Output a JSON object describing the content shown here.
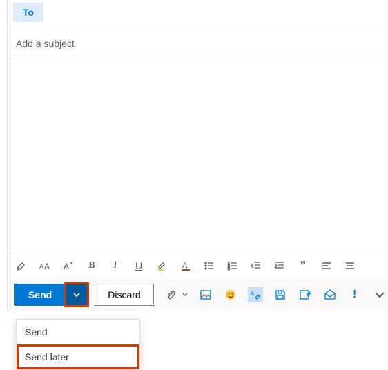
{
  "compose": {
    "to_label": "To",
    "subject_placeholder": "Add a subject"
  },
  "format": {
    "bold": "B",
    "italic": "I",
    "underline": "U",
    "highlight": "🖌",
    "font_color": "A",
    "quote": "❞"
  },
  "actions": {
    "send_label": "Send",
    "discard_label": "Discard",
    "importance": "!"
  },
  "send_menu": {
    "items": [
      {
        "label": "Send"
      },
      {
        "label": "Send later"
      }
    ]
  }
}
